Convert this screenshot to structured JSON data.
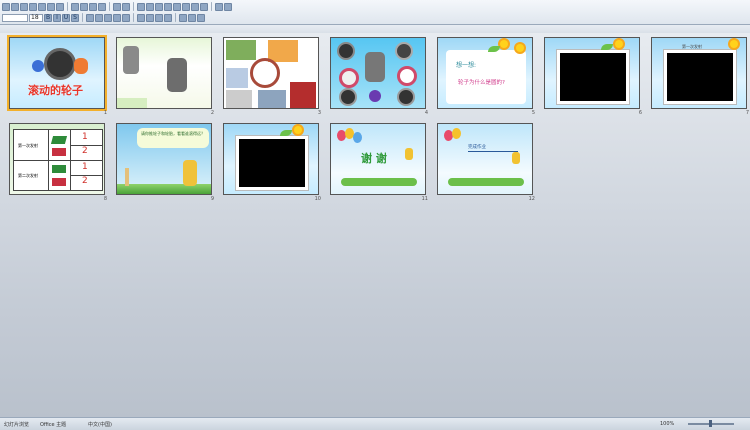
{
  "toolbar": {
    "font_size_value": "18",
    "zoom_value": "100%"
  },
  "slides": [
    {
      "num": "1",
      "title": "滚动的轮子"
    },
    {
      "num": "2"
    },
    {
      "num": "3"
    },
    {
      "num": "4"
    },
    {
      "num": "5",
      "line1": "想一想:",
      "line2": "轮子为什么是圆的?"
    },
    {
      "num": "6"
    },
    {
      "num": "7",
      "caption": "第一次发射"
    },
    {
      "num": "8",
      "rows": [
        {
          "label": "第一次发射",
          "values": [
            "1",
            "2"
          ]
        },
        {
          "label": "第二次发射",
          "values": [
            "1",
            "2"
          ]
        }
      ]
    },
    {
      "num": "9",
      "bubble": "请你推轮子和轮胎，看看谁滚得远？"
    },
    {
      "num": "10"
    },
    {
      "num": "11",
      "text": "谢 谢"
    },
    {
      "num": "12",
      "text": "完成作业"
    }
  ],
  "status": {
    "slide_view": "幻灯片浏览",
    "theme": "Office 主题",
    "language": "中文(中国)",
    "zoom": "100%"
  },
  "colors": {
    "accent": "#f3b02b",
    "title_red": "#e8362b",
    "thanks_green": "#2f9a3a"
  }
}
